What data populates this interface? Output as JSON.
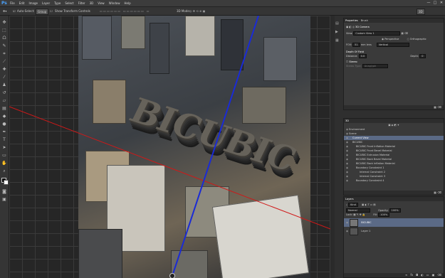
{
  "app": {
    "logo": "Ps"
  },
  "menu": [
    "File",
    "Edit",
    "Image",
    "Layer",
    "Type",
    "Select",
    "Filter",
    "3D",
    "View",
    "Window",
    "Help"
  ],
  "window_controls": [
    "—",
    "□",
    "✕"
  ],
  "options_bar": {
    "auto_select_label": "Auto-Select:",
    "auto_select_value": "Group",
    "show_transform_label": "Show Transform Controls",
    "mode_label": "3D Mode:",
    "workspace": "3D"
  },
  "canvas": {
    "title_text": "BICUBIC"
  },
  "properties_panel": {
    "tabs": [
      "Properties",
      "Brush"
    ],
    "header": "3D Camera",
    "view_label": "View:",
    "view_value": "Custom View 1",
    "perspective_label": "Perspective",
    "orthographic_label": "Orthographic",
    "fov_label": "FOV:",
    "fov_value": "51",
    "fov_unit": "mm lens",
    "fov_option": "Vertical",
    "dof_header": "Depth Of Field",
    "distance_label": "Distance:",
    "distance_value": "0.0",
    "depth_label": "Depth:",
    "depth_value": "0",
    "stereo_header": "Stereo",
    "stereo_type_label": "Stereo Type:",
    "stereo_type_value": "Anaglyph"
  },
  "scene_panel": {
    "tab": "3D",
    "items": [
      {
        "label": "Environment",
        "selected": false,
        "indent": 0
      },
      {
        "label": "Scene",
        "selected": false,
        "indent": 0
      },
      {
        "label": "Current View",
        "selected": true,
        "indent": 1
      },
      {
        "label": "BICUBIC",
        "selected": false,
        "indent": 1
      },
      {
        "label": "BICUBIC Front Inflation Material",
        "selected": false,
        "indent": 2
      },
      {
        "label": "BICUBIC Front Bevel Material",
        "selected": false,
        "indent": 2
      },
      {
        "label": "BICUBIC Extrusion Material",
        "selected": false,
        "indent": 2
      },
      {
        "label": "BICUBIC Back Bevel Material",
        "selected": false,
        "indent": 2
      },
      {
        "label": "BICUBIC Back Inflation Material",
        "selected": false,
        "indent": 2
      },
      {
        "label": "Boundary Constraint 1",
        "selected": false,
        "indent": 2
      },
      {
        "label": "Internal Constraint 2",
        "selected": false,
        "indent": 3
      },
      {
        "label": "Internal Constraint 3",
        "selected": false,
        "indent": 3
      },
      {
        "label": "Boundary Constraint 4",
        "selected": false,
        "indent": 2
      }
    ]
  },
  "layers_panel": {
    "tab": "Layers",
    "kind_label": "Kind",
    "blend_mode": "Normal",
    "opacity_label": "Opacity:",
    "opacity_value": "100%",
    "lock_label": "Lock:",
    "fill_label": "Fill:",
    "fill_value": "100%",
    "layers": [
      {
        "name": "BICUBIC",
        "selected": true
      },
      {
        "name": "Layer 1",
        "selected": false
      }
    ]
  },
  "colors": {
    "selection": "#5b6a86",
    "accent": "#4aa3ff",
    "red_axis": "#d01818",
    "blue_axis": "#1a2bd6"
  }
}
